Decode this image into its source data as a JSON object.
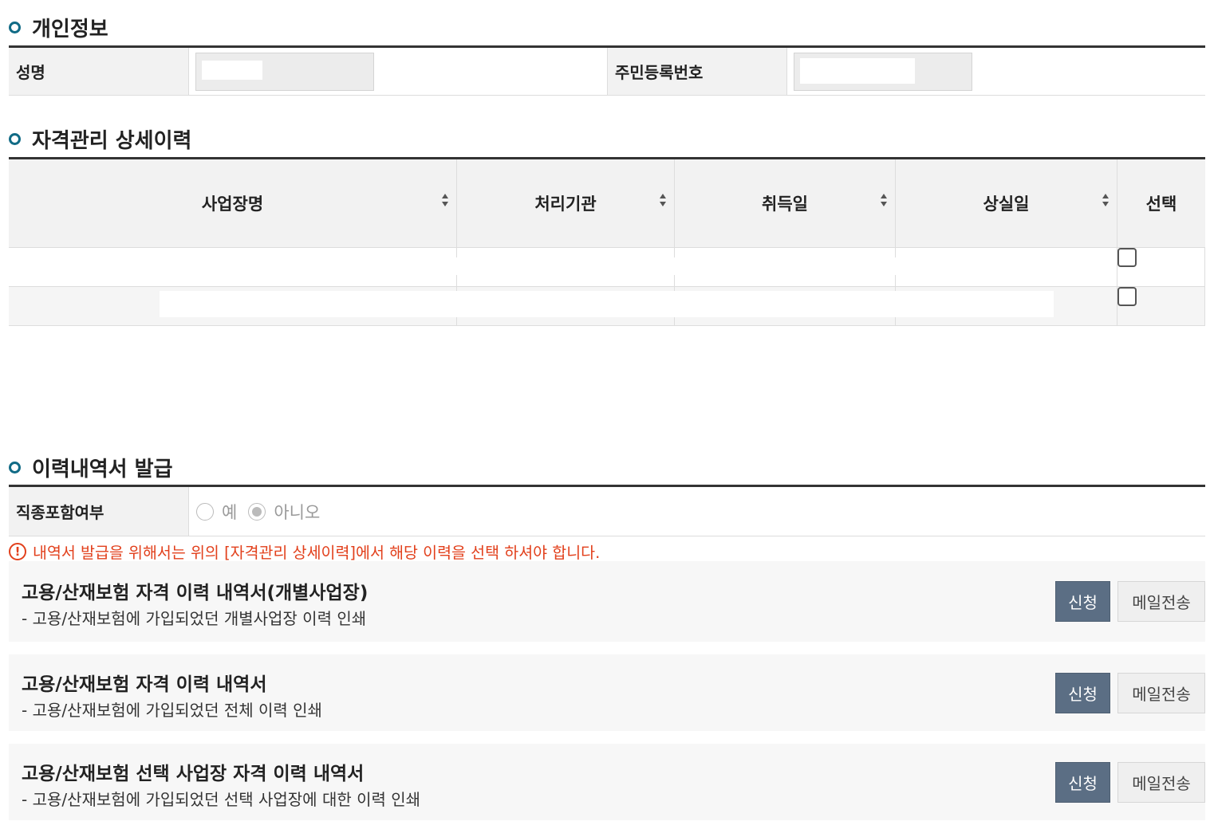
{
  "personal": {
    "title": "개인정보",
    "name_label": "성명",
    "rrn_label": "주민등록번호",
    "name_value": "",
    "rrn_value": ""
  },
  "history": {
    "title": "자격관리 상세이력",
    "columns": [
      "사업장명",
      "처리기관",
      "취득일",
      "상실일",
      "선택"
    ]
  },
  "issue": {
    "title": "이력내역서 발급",
    "job_label": "직종포함여부",
    "option_yes": "예",
    "option_no": "아니오",
    "warning": "내역서 발급을 위해서는 위의 [자격관리 상세이력]에서 해당 이력을 선택 하셔야 합니다.",
    "warning_icon": "!",
    "docs": [
      {
        "title": "고용/산재보험 자격 이력 내역서(개별사업장)",
        "desc": "- 고용/산재보험에 가입되었던 개별사업장 이력 인쇄",
        "apply": "신청",
        "mail": "메일전송"
      },
      {
        "title": "고용/산재보험 자격 이력 내역서",
        "desc": "- 고용/산재보험에 가입되었던 전체 이력 인쇄",
        "apply": "신청",
        "mail": "메일전송"
      },
      {
        "title": "고용/산재보험 선택 사업장 자격 이력 내역서",
        "desc": "- 고용/산재보험에 가입되었던 선택 사업장에 대한 이력 인쇄",
        "apply": "신청",
        "mail": "메일전송"
      }
    ]
  },
  "colors": {
    "accent": "#116b86",
    "apply_button": "#5b6e84",
    "warning": "#e2401c"
  }
}
